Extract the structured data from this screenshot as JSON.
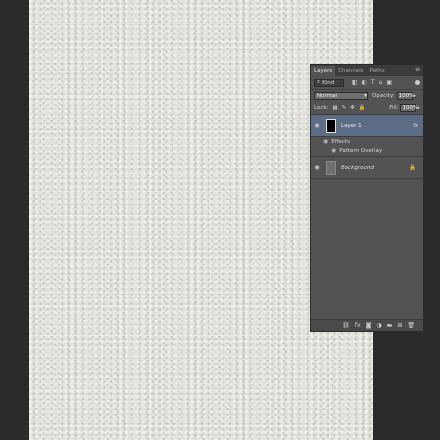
{
  "layers_panel": {
    "tabs": [
      {
        "label": "Layers",
        "active": true
      },
      {
        "label": "Channels",
        "active": false
      },
      {
        "label": "Paths",
        "active": false
      }
    ],
    "menu_icon": "≡",
    "filter": {
      "kind_label": "Kind",
      "icons": [
        "◧",
        "◐",
        "T",
        "⌂",
        "▣"
      ]
    },
    "blend_mode": "Normal",
    "opacity_label": "Opacity:",
    "opacity_value": "100%",
    "lock_label": "Lock:",
    "lock_icons": [
      "▦",
      "✎",
      "✥",
      "🔒"
    ],
    "fill_label": "Fill:",
    "fill_value": "100%",
    "layers": [
      {
        "name": "Layer 1",
        "selected": true,
        "fx": "fx"
      },
      {
        "name": "Background",
        "selected": false
      }
    ],
    "effects": {
      "label": "Effects",
      "items": [
        "Pattern Overlay"
      ]
    },
    "footer_icons": [
      "⛓",
      "fx",
      "◙",
      "◑",
      "▬",
      "⊞",
      "🗑"
    ]
  },
  "colors": {
    "workspace": "#2a2a2a",
    "canvas": "#e2e2db",
    "panel_bg": "#535353",
    "selection": "#5d6c85"
  }
}
